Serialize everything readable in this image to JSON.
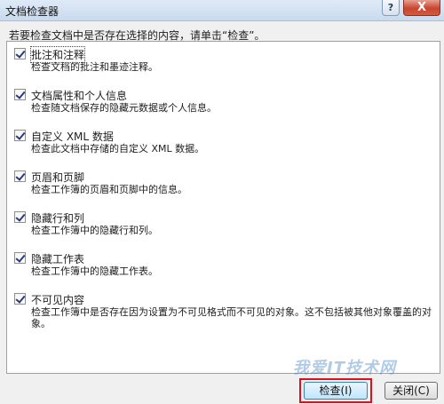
{
  "window": {
    "title": "文档检查器",
    "help_glyph": "?",
    "close_glyph": "X"
  },
  "instruction": "若要检查文档中是否存在选择的内容，请单击“检查”。",
  "items": [
    {
      "label": "批注和注释",
      "checked": true,
      "description": "检查文档的批注和墨迹注释。"
    },
    {
      "label": "文档属性和个人信息",
      "checked": true,
      "description": "检查随文档保存的隐藏元数据或个人信息。"
    },
    {
      "label": "自定义 XML 数据",
      "checked": true,
      "description": "检查此文档中存储的自定义 XML 数据。"
    },
    {
      "label": "页眉和页脚",
      "checked": true,
      "description": "检查工作簿的页眉和页脚中的信息。"
    },
    {
      "label": "隐藏行和列",
      "checked": true,
      "description": "检查工作簿中的隐藏行和列。"
    },
    {
      "label": "隐藏工作表",
      "checked": true,
      "description": "检查工作簿中的隐藏工作表。"
    },
    {
      "label": "不可见内容",
      "checked": true,
      "description": "检查工作簿中是否存在因为设置为不可见格式而不可见的对象。这不包括被其他对象覆盖的对象。"
    }
  ],
  "buttons": {
    "inspect": "检查(I)",
    "close": "关闭(C)"
  },
  "watermark": "我爱IT技术网"
}
